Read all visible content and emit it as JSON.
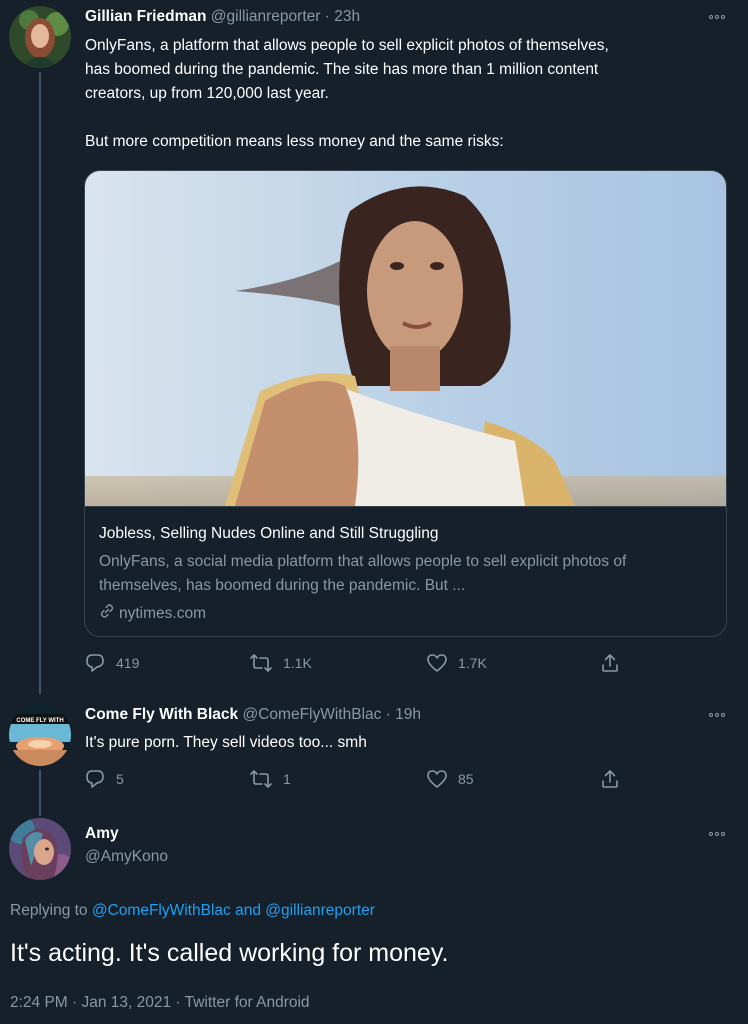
{
  "tweet1": {
    "name": "Gillian Friedman",
    "handle": "@gillianreporter",
    "time": "· 23h",
    "text": "OnlyFans, a platform that allows people to sell explicit photos of themselves,\nhas boomed during the pandemic. The site has more than 1 million content\ncreators, up from 120,000 last year.\n\nBut more competition means less money and the same risks:",
    "card": {
      "title": "Jobless, Selling Nudes Online and Still Struggling",
      "description": "OnlyFans, a social media platform that allows people to sell explicit photos of themselves, has boomed during the pandemic. But ...",
      "domain": "nytimes.com"
    },
    "actions": {
      "replies": "419",
      "retweets": "1.1K",
      "likes": "1.7K"
    }
  },
  "tweet2": {
    "name": "Come Fly With Black",
    "handle": "@ComeFlyWithBlac",
    "time": "· 19h",
    "text": "It's pure porn. They sell videos too... smh",
    "avatar_text": "COME FLY WITH",
    "actions": {
      "replies": "5",
      "retweets": "1",
      "likes": "85"
    }
  },
  "main_tweet": {
    "name": "Amy",
    "handle": "@AmyKono",
    "replying_prefix": "Replying to",
    "reply_user1": "@ComeFlyWithBlac",
    "reply_and": "and",
    "reply_user2": "@gillianreporter",
    "text": "It's acting. It's called working for money.",
    "timestamp": "2:24 PM · Jan 13, 2021 · Twitter for Android"
  },
  "colors": {
    "background": "#15202b",
    "secondary_text": "#8899a6",
    "link": "#1da1f2",
    "border": "#38444d"
  },
  "icons": [
    "reply-icon",
    "retweet-icon",
    "like-icon",
    "share-icon",
    "more-icon",
    "link-icon"
  ]
}
